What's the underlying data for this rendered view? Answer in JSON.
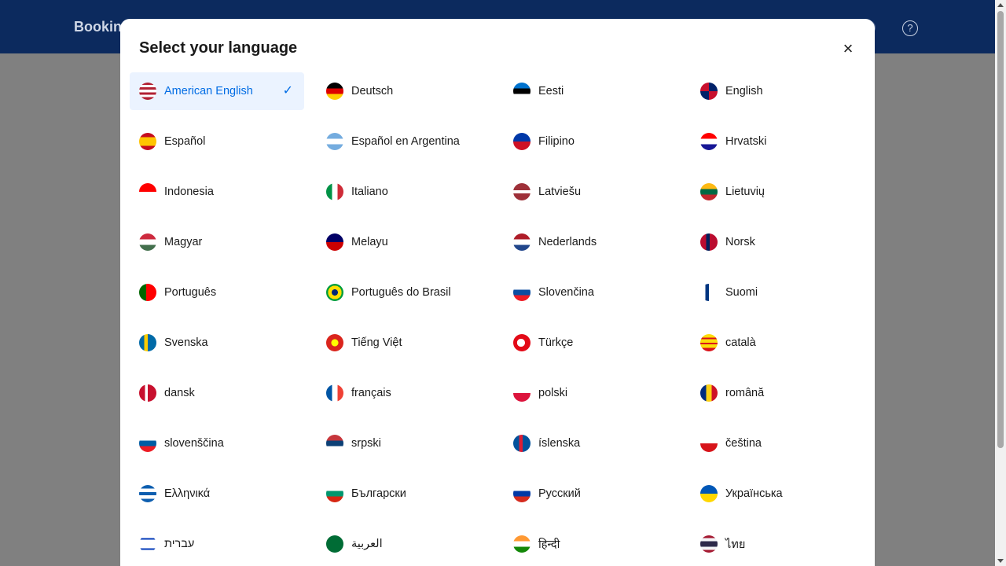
{
  "header": {
    "brand": "Booking",
    "help_icon": "?"
  },
  "modal": {
    "title": "Select your language",
    "close_icon": "×",
    "check_icon": "✓",
    "languages": [
      {
        "label": "American English",
        "selected": true,
        "flag": "linear-gradient(180deg,#b22234 0 14%,#fff 14% 28%,#b22234 28% 42%,#fff 42% 57%,#b22234 57% 71%,#fff 71% 85%,#b22234 85%)"
      },
      {
        "label": "Deutsch",
        "flag": "linear-gradient(180deg,#000 0 33%,#dd0000 33% 66%,#ffce00 66%)"
      },
      {
        "label": "Eesti",
        "flag": "linear-gradient(180deg,#0072ce 0 33%,#000 33% 66%,#fff 66%)"
      },
      {
        "label": "English",
        "flag": "conic-gradient(#012169 0 25%,#c8102e 25% 50%,#012169 50% 75%,#c8102e 75%)"
      },
      {
        "label": "Español",
        "flag": "linear-gradient(180deg,#c60b1e 0 25%,#ffc400 25% 75%,#c60b1e 75%)"
      },
      {
        "label": "Español en Argentina",
        "flag": "linear-gradient(180deg,#74acdf 0 33%,#fff 33% 66%,#74acdf 66%)"
      },
      {
        "label": "Filipino",
        "flag": "linear-gradient(180deg,#0038a8 0 50%,#ce1126 50%)"
      },
      {
        "label": "Hrvatski",
        "flag": "linear-gradient(180deg,#ff0000 0 33%,#fff 33% 66%,#171796 66%)"
      },
      {
        "label": "Indonesia",
        "flag": "linear-gradient(180deg,#ff0000 0 50%,#fff 50%)"
      },
      {
        "label": "Italiano",
        "flag": "linear-gradient(90deg,#009246 0 33%,#fff 33% 66%,#ce2b37 66%)"
      },
      {
        "label": "Latviešu",
        "flag": "linear-gradient(180deg,#9e3039 0 40%,#fff 40% 60%,#9e3039 60%)"
      },
      {
        "label": "Lietuvių",
        "flag": "linear-gradient(180deg,#fdb913 0 33%,#006a44 33% 66%,#c1272d 66%)"
      },
      {
        "label": "Magyar",
        "flag": "linear-gradient(180deg,#cd2a3e 0 33%,#fff 33% 66%,#436f4d 66%)"
      },
      {
        "label": "Melayu",
        "flag": "linear-gradient(180deg,#010066 0 50%,#cc0001 50%)"
      },
      {
        "label": "Nederlands",
        "flag": "linear-gradient(180deg,#ae1c28 0 33%,#fff 33% 66%,#21468b 66%)"
      },
      {
        "label": "Norsk",
        "flag": "linear-gradient(90deg,#ba0c2f 0 35%,#00205b 35% 55%,#ba0c2f 55%)"
      },
      {
        "label": "Português",
        "flag": "linear-gradient(90deg,#006600 0 40%,#ff0000 40%)"
      },
      {
        "label": "Português do Brasil",
        "flag": "radial-gradient(circle,#002776 0 25%,#ffdf00 26% 55%,#009c3b 56%)"
      },
      {
        "label": "Slovenčina",
        "flag": "linear-gradient(180deg,#fff 0 33%,#0b4ea2 33% 66%,#ee1c25 66%)"
      },
      {
        "label": "Suomi",
        "flag": "linear-gradient(90deg,#fff 0 30%,#003580 30% 50%,#fff 50%)"
      },
      {
        "label": "Svenska",
        "flag": "linear-gradient(90deg,#006aa7 0 30%,#fecc00 30% 50%,#006aa7 50%)"
      },
      {
        "label": "Tiếng Việt",
        "flag": "radial-gradient(circle,#ffff00 0 28%,#da251d 30%)"
      },
      {
        "label": "Türkçe",
        "flag": "radial-gradient(circle at 45% 50%,#fff 0 30%,#e30a17 32%)"
      },
      {
        "label": "català",
        "flag": "linear-gradient(180deg,#fcdd09 0 20%,#da121a 20% 30%,#fcdd09 30% 50%,#da121a 50% 60%,#fcdd09 60% 80%,#da121a 80%)"
      },
      {
        "label": "dansk",
        "flag": "linear-gradient(90deg,#c8102e 0 35%,#fff 35% 50%,#c8102e 50%)"
      },
      {
        "label": "français",
        "flag": "linear-gradient(90deg,#0055a4 0 33%,#fff 33% 66%,#ef4135 66%)"
      },
      {
        "label": "polski",
        "flag": "linear-gradient(180deg,#fff 0 50%,#dc143c 50%)"
      },
      {
        "label": "română",
        "flag": "linear-gradient(90deg,#002b7f 0 33%,#fcd116 33% 66%,#ce1126 66%)"
      },
      {
        "label": "slovenščina",
        "flag": "linear-gradient(180deg,#fff 0 33%,#005da4 33% 66%,#ed1c24 66%)"
      },
      {
        "label": "srpski",
        "flag": "linear-gradient(180deg,#c6363c 0 33%,#0c4076 33% 66%,#fff 66%)"
      },
      {
        "label": "íslenska",
        "flag": "linear-gradient(90deg,#02529c 0 33%,#dc1e35 33% 55%,#02529c 55%)"
      },
      {
        "label": "čeština",
        "flag": "linear-gradient(180deg,#fff 0 50%,#d7141a 50%)"
      },
      {
        "label": "Ελληνικά",
        "flag": "linear-gradient(180deg,#0d5eaf 0 20%,#fff 20% 40%,#0d5eaf 40% 60%,#fff 60% 80%,#0d5eaf 80%)"
      },
      {
        "label": "Български",
        "flag": "linear-gradient(180deg,#fff 0 33%,#00966e 33% 66%,#d62612 66%)"
      },
      {
        "label": "Русский",
        "flag": "linear-gradient(180deg,#fff 0 33%,#0039a6 33% 66%,#d52b1e 66%)"
      },
      {
        "label": "Українська",
        "flag": "linear-gradient(180deg,#0057b7 0 50%,#ffd700 50%)"
      },
      {
        "label": "עברית",
        "flag": "linear-gradient(180deg,#fff 0 15%,#0038b8 15% 25%,#fff 25% 75%,#0038b8 75% 85%,#fff 85%)"
      },
      {
        "label": "العربية",
        "flag": "linear-gradient(180deg,#006c35 0 100%)"
      },
      {
        "label": "हिन्दी",
        "flag": "linear-gradient(180deg,#ff9933 0 33%,#fff 33% 66%,#138808 66%)"
      },
      {
        "label": "ไทย",
        "flag": "linear-gradient(180deg,#a51931 0 17%,#f4f5f8 17% 33%,#2d2a4a 33% 67%,#f4f5f8 67% 83%,#a51931 83%)"
      }
    ]
  }
}
